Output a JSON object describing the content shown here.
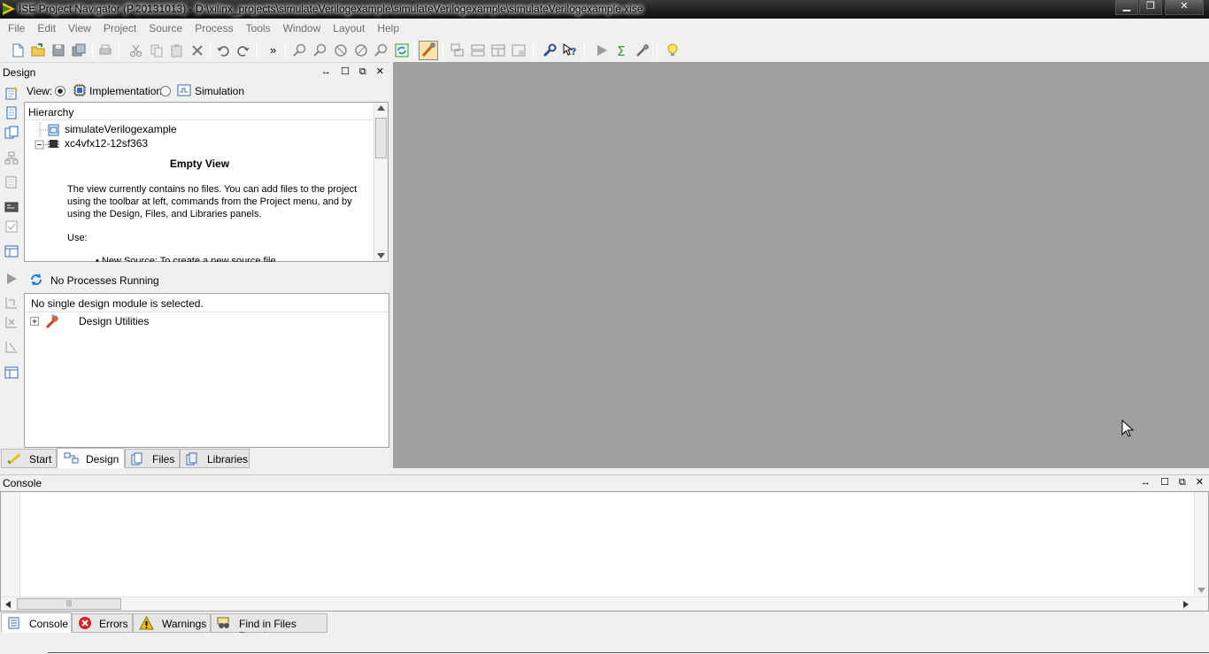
{
  "window": {
    "title": "ISE Project Navigator (P.20131013) - D:\\xilinx_projects\\simulateVerilogexample\\simulateVerilogexample\\simulateVerilogexample.xise",
    "minimize": "▁",
    "restore": "❐",
    "close": "✕"
  },
  "menu": [
    "File",
    "Edit",
    "View",
    "Project",
    "Source",
    "Process",
    "Tools",
    "Window",
    "Layout",
    "Help"
  ],
  "toolbar": {
    "overflow": "»"
  },
  "design_panel": {
    "title": "Design",
    "controls": "↔ ☐ ⧉ ✕",
    "view_label": "View:",
    "view_implementation": "Implementation",
    "view_simulation": "Simulation",
    "hierarchy_header": "Hierarchy",
    "tree": {
      "project": "simulateVerilogexample",
      "device": "xc4vfx12-12sf363"
    },
    "empty_view": {
      "heading": "Empty View",
      "body_line1": "The view currently contains no files. You can add files to the project",
      "body_line2": "using the toolbar at left, commands from the Project menu, and by",
      "body_line3": "using the Design, Files, and Libraries panels.",
      "use_label": "Use:",
      "bullet_partial": "• New Source: To create a new source file"
    },
    "process_status": "No Processes Running",
    "process_header": "No single design module is selected.",
    "process_item": "Design Utilities"
  },
  "left_tabs": [
    {
      "label": "Start"
    },
    {
      "label": "Design"
    },
    {
      "label": "Files"
    },
    {
      "label": "Libraries"
    }
  ],
  "console_panel": {
    "title": "Console",
    "controls": "↔ ☐ ⧉ ✕",
    "scroll_thumb": "|||"
  },
  "console_tabs": [
    {
      "label": "Console"
    },
    {
      "label": "Errors"
    },
    {
      "label": "Warnings"
    },
    {
      "label": "Find in Files Results"
    }
  ],
  "colors": {
    "workspace": "#a0a0a0",
    "titlebar": "#1b1b1b",
    "menu_disabled_text": "#6d6d6d",
    "error_red": "#d42020",
    "warning_yellow": "#f2c400"
  }
}
